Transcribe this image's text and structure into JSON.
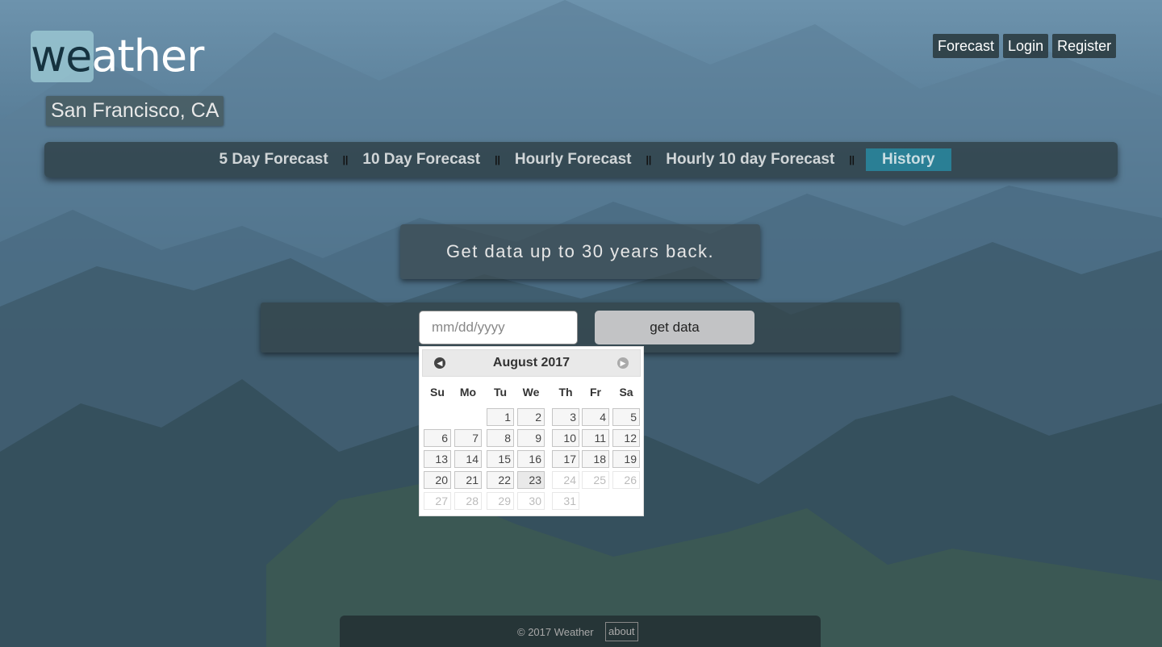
{
  "brand": {
    "logo_prefix": "we",
    "logo_suffix": "ather"
  },
  "location": "San Francisco, CA",
  "top_nav": [
    "Forecast",
    "Login",
    "Register"
  ],
  "tabs": [
    {
      "label": "5 Day Forecast",
      "active": false
    },
    {
      "label": "10 Day Forecast",
      "active": false
    },
    {
      "label": "Hourly Forecast",
      "active": false
    },
    {
      "label": "Hourly 10 day Forecast",
      "active": false
    },
    {
      "label": "History",
      "active": true
    }
  ],
  "tab_separator": "||",
  "banner": "Get data up to 30 years back.",
  "form": {
    "date_placeholder": "mm/dd/yyyy",
    "date_value": "",
    "button_label": "get data"
  },
  "calendar": {
    "title": "August 2017",
    "weekdays": [
      "Su",
      "Mo",
      "Tu",
      "We",
      "Th",
      "Fr",
      "Sa"
    ],
    "first_weekday": 2,
    "days_in_month": 31,
    "today": 23,
    "max_enabled": 23
  },
  "footer": {
    "copyright": "© 2017 Weather",
    "about": "about"
  }
}
